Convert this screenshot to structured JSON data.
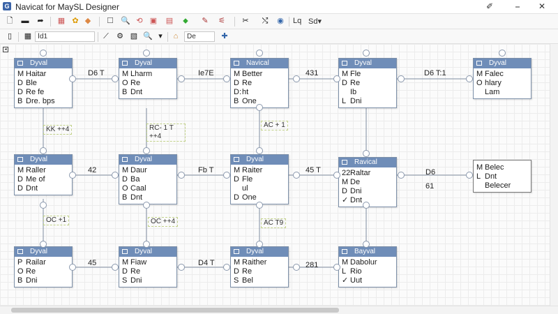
{
  "window": {
    "title": "Navicat for MaySL Designer",
    "icon_letter": "G",
    "minimize": "⎯",
    "close": "✕",
    "pin_icon": "pin-icon"
  },
  "toolbar": {
    "view_label": "Sd▾",
    "layer_label": "Ⅰd1",
    "font_label": "De",
    "zoom_label": "Lq"
  },
  "colors": {
    "header": "#6f8db8",
    "border": "#7c8fa8",
    "note_border": "#c2d28a"
  },
  "entities": [
    {
      "title": "Dyval",
      "fields": [
        [
          "M",
          "Haitar"
        ],
        [
          "D",
          "Ble"
        ],
        [
          "D",
          "Re fe"
        ],
        [
          "B",
          "Dre. bps"
        ]
      ]
    },
    {
      "title": "Dyval",
      "fields": [
        [
          "M",
          "Lharm"
        ],
        [
          "O",
          "Re"
        ],
        [
          "B",
          "Dnt"
        ]
      ]
    },
    {
      "title": "Navical",
      "fields": [
        [
          "M",
          "Better"
        ],
        [
          "D",
          "Re"
        ],
        [
          "D:",
          "ht"
        ],
        [
          "B",
          "One"
        ]
      ]
    },
    {
      "title": "Dyval",
      "fields": [
        [
          "M",
          "Fle"
        ],
        [
          "D",
          "Re"
        ],
        [
          "",
          "Ib"
        ],
        [
          "L",
          "Dni"
        ]
      ]
    },
    {
      "title": "Dyval",
      "fields": [
        [
          "M",
          "Falec"
        ],
        [
          "O",
          "hlary"
        ],
        [
          "",
          "Lam"
        ]
      ]
    },
    {
      "title": "Dyval",
      "fields": [
        [
          "M",
          "Raller"
        ],
        [
          "D",
          "Me of"
        ],
        [
          "D",
          "Dnt"
        ]
      ]
    },
    {
      "title": "Dyval",
      "fields": [
        [
          "M",
          "Daur"
        ],
        [
          "D",
          "Ba"
        ],
        [
          "O",
          "Caal"
        ],
        [
          "B",
          "Dnt"
        ]
      ]
    },
    {
      "title": "Dyval",
      "fields": [
        [
          "M",
          "Raiter"
        ],
        [
          "D",
          "Fle"
        ],
        [
          "",
          "ul"
        ],
        [
          "D",
          "One"
        ]
      ]
    },
    {
      "title": "Ravical",
      "fields": [
        [
          "22",
          "Raltar"
        ],
        [
          "M",
          "De"
        ],
        [
          "D",
          "Dni"
        ],
        [
          "✓",
          "Dnt"
        ]
      ]
    },
    {
      "title": "",
      "fields": [
        [
          "M",
          "Belec"
        ],
        [
          "L",
          "Dnt"
        ],
        [
          "",
          "Belecer"
        ]
      ]
    },
    {
      "title": "Dyval",
      "fields": [
        [
          "P",
          "Railar"
        ],
        [
          "O",
          "Re"
        ],
        [
          "B",
          "Dni"
        ]
      ]
    },
    {
      "title": "Dyval",
      "fields": [
        [
          "M",
          "Fiaw"
        ],
        [
          "D",
          "Re"
        ],
        [
          "S",
          "Dni"
        ]
      ]
    },
    {
      "title": "Dyval",
      "fields": [
        [
          "M",
          "Raither"
        ],
        [
          "D",
          "Re"
        ],
        [
          "S",
          "Bel"
        ]
      ]
    },
    {
      "title": "Bayval",
      "fields": [
        [
          "M",
          "Dabolur"
        ],
        [
          "L",
          "Rio"
        ],
        [
          "✓",
          "Uut"
        ]
      ]
    }
  ],
  "relations": [
    "D6 T",
    "Ie7E",
    "431",
    "D6 T:1",
    "42",
    "Fb T",
    "45 T",
    "D6",
    "61",
    "45",
    "D4 T",
    "281"
  ],
  "notes": [
    "KK ++4",
    "RC- 1 T ++4",
    "AC + 1",
    "OC +1",
    "OC ++4",
    "AC T9"
  ]
}
